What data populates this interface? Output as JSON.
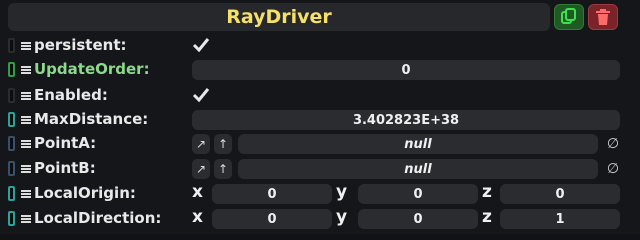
{
  "component": {
    "title": "RayDriver"
  },
  "header": {
    "duplicate_icon": "copy-icon",
    "delete_icon": "trash-icon"
  },
  "fields": {
    "persistent": {
      "label": "persistent:",
      "checked": true
    },
    "update_order": {
      "label": "UpdateOrder:",
      "value": "0"
    },
    "enabled": {
      "label": "Enabled:",
      "checked": true
    },
    "max_distance": {
      "label": "MaxDistance:",
      "value": "3.402823E+38"
    },
    "point_a": {
      "label": "PointA:",
      "value": "null",
      "btn1": "↗",
      "btn2": "↑",
      "clear": "∅"
    },
    "point_b": {
      "label": "PointB:",
      "value": "null",
      "btn1": "↗",
      "btn2": "↑",
      "clear": "∅"
    },
    "local_origin": {
      "label": "LocalOrigin:",
      "x_label": "x",
      "y_label": "y",
      "z_label": "z",
      "x": "0",
      "y": "0",
      "z": "0"
    },
    "local_direction": {
      "label": "LocalDirection:",
      "x_label": "x",
      "y_label": "y",
      "z_label": "z",
      "x": "0",
      "y": "0",
      "z": "1"
    }
  },
  "colors": {
    "title": "#f5e06a",
    "background": "#151619",
    "field_bg": "#2a2c30",
    "duplicate_button": "#1f5a24",
    "delete_button": "#7a2328"
  }
}
